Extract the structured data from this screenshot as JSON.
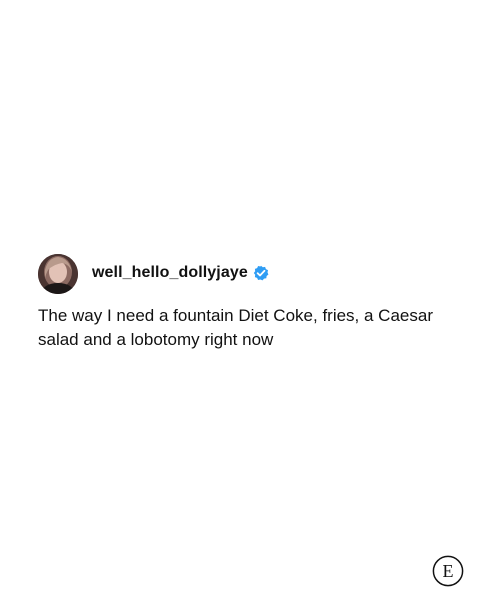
{
  "post": {
    "avatar_icon": "user-photo-avatar",
    "username": "well_hello_dollyjaye",
    "verified_icon": "verified-badge-icon",
    "verified_color": "#2f9df4",
    "text": "The way I need a fountain Diet Coke, fries, a Caesar salad and a lobotomy right now"
  },
  "brand": {
    "logo_icon": "e-monogram-logo",
    "logo_letter": "E"
  }
}
